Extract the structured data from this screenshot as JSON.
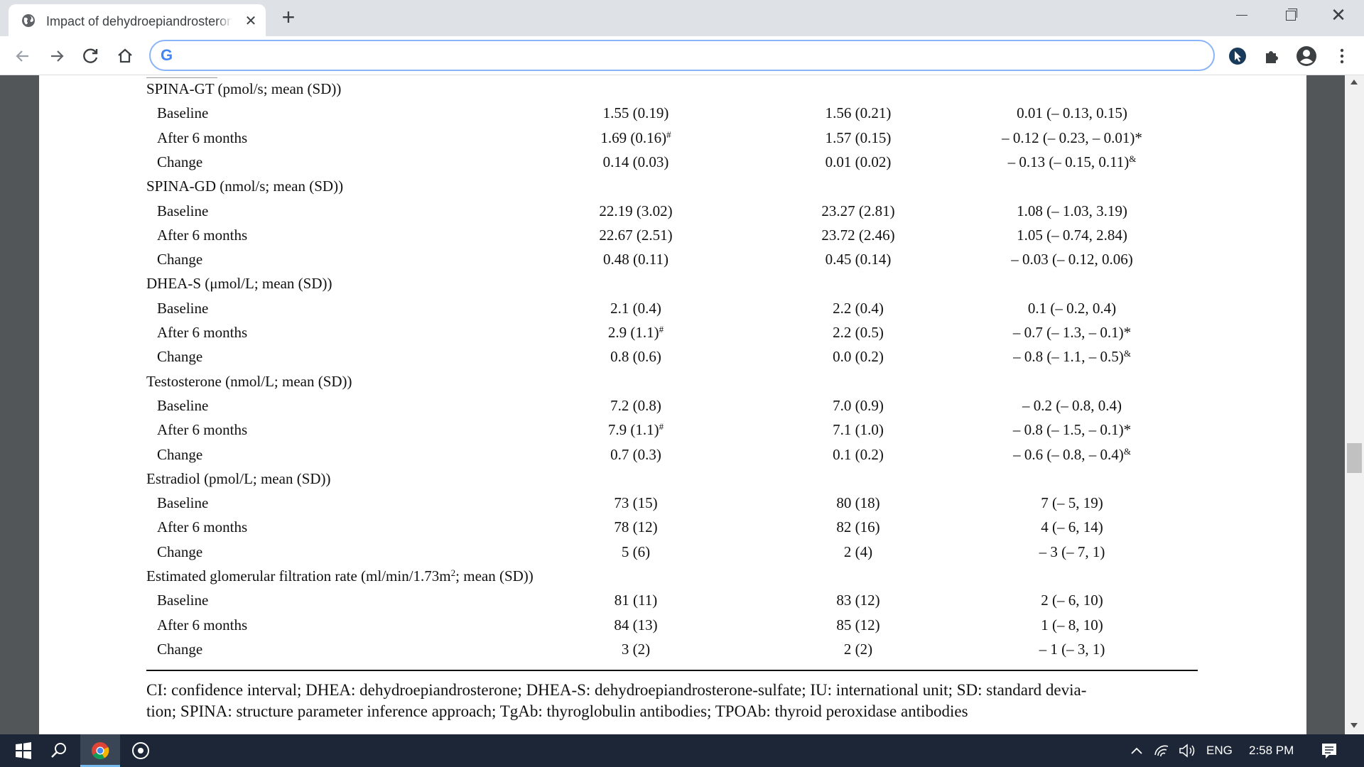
{
  "browser": {
    "tab_title": "Impact of dehydroepiandrosterone",
    "tab_close": "✕",
    "new_tab": "+",
    "window_close": "✕",
    "omnibox_value": ""
  },
  "table": {
    "groups": [
      {
        "label": "SPINA-GT (pmol/s; mean (SD))",
        "rows": [
          {
            "name": "Baseline",
            "c1": "1.55 (0.19)",
            "c1_sup": "",
            "c2": "1.56 (0.21)",
            "c3": "0.01 (– 0.13, 0.15)",
            "c3_sup": ""
          },
          {
            "name": "After 6 months",
            "c1": "1.69 (0.16)",
            "c1_sup": "#",
            "c2": "1.57 (0.15)",
            "c3": "– 0.12 (– 0.23, – 0.01)*",
            "c3_sup": ""
          },
          {
            "name": "Change",
            "c1": "0.14 (0.03)",
            "c1_sup": "",
            "c2": "0.01 (0.02)",
            "c3": "– 0.13 (– 0.15, 0.11)",
            "c3_sup": "&"
          }
        ]
      },
      {
        "label": "SPINA-GD (nmol/s; mean (SD))",
        "rows": [
          {
            "name": "Baseline",
            "c1": "22.19 (3.02)",
            "c1_sup": "",
            "c2": "23.27 (2.81)",
            "c3": "1.08 (– 1.03, 3.19)",
            "c3_sup": ""
          },
          {
            "name": "After 6 months",
            "c1": "22.67 (2.51)",
            "c1_sup": "",
            "c2": "23.72 (2.46)",
            "c3": "1.05 (– 0.74, 2.84)",
            "c3_sup": ""
          },
          {
            "name": "Change",
            "c1": "0.48 (0.11)",
            "c1_sup": "",
            "c2": "0.45 (0.14)",
            "c3": "– 0.03 (– 0.12, 0.06)",
            "c3_sup": ""
          }
        ]
      },
      {
        "label": "DHEA-S (μmol/L; mean (SD))",
        "rows": [
          {
            "name": "Baseline",
            "c1": "2.1 (0.4)",
            "c1_sup": "",
            "c2": "2.2 (0.4)",
            "c3": "0.1 (– 0.2, 0.4)",
            "c3_sup": ""
          },
          {
            "name": "After 6 months",
            "c1": "2.9 (1.1)",
            "c1_sup": "#",
            "c2": "2.2 (0.5)",
            "c3": "– 0.7 (– 1.3, – 0.1)*",
            "c3_sup": ""
          },
          {
            "name": "Change",
            "c1": "0.8 (0.6)",
            "c1_sup": "",
            "c2": "0.0 (0.2)",
            "c3": "– 0.8 (– 1.1, – 0.5)",
            "c3_sup": "&"
          }
        ]
      },
      {
        "label": "Testosterone (nmol/L; mean (SD))",
        "rows": [
          {
            "name": "Baseline",
            "c1": "7.2 (0.8)",
            "c1_sup": "",
            "c2": "7.0 (0.9)",
            "c3": "– 0.2 (– 0.8, 0.4)",
            "c3_sup": ""
          },
          {
            "name": "After 6 months",
            "c1": "7.9 (1.1)",
            "c1_sup": "#",
            "c2": "7.1 (1.0)",
            "c3": "– 0.8 (– 1.5, – 0.1)*",
            "c3_sup": ""
          },
          {
            "name": "Change",
            "c1": "0.7 (0.3)",
            "c1_sup": "",
            "c2": "0.1 (0.2)",
            "c3": "– 0.6 (– 0.8, – 0.4)",
            "c3_sup": "&"
          }
        ]
      },
      {
        "label": "Estradiol (pmol/L; mean (SD))",
        "rows": [
          {
            "name": "Baseline",
            "c1": "73 (15)",
            "c1_sup": "",
            "c2": "80 (18)",
            "c3": "7 (– 5, 19)",
            "c3_sup": ""
          },
          {
            "name": "After 6 months",
            "c1": "78 (12)",
            "c1_sup": "",
            "c2": "82 (16)",
            "c3": "4 (– 6, 14)",
            "c3_sup": ""
          },
          {
            "name": "Change",
            "c1": "5 (6)",
            "c1_sup": "",
            "c2": "2 (4)",
            "c3": "– 3 (– 7, 1)",
            "c3_sup": ""
          }
        ]
      },
      {
        "label_before": "Estimated glomerular filtration rate (ml/min/1.73m",
        "label_sup": "2",
        "label_after": "; mean (SD))",
        "rows": [
          {
            "name": "Baseline",
            "c1": "81 (11)",
            "c1_sup": "",
            "c2": "83 (12)",
            "c3": "2 (– 6, 10)",
            "c3_sup": ""
          },
          {
            "name": "After 6 months",
            "c1": "84 (13)",
            "c1_sup": "",
            "c2": "85 (12)",
            "c3": "1 (– 8, 10)",
            "c3_sup": ""
          },
          {
            "name": "Change",
            "c1": "3 (2)",
            "c1_sup": "",
            "c2": "2 (2)",
            "c3": "– 1 (– 3, 1)",
            "c3_sup": ""
          }
        ]
      }
    ],
    "footnote_line1": "CI: confidence interval; DHEA: dehydroepiandrosterone; DHEA-S: dehydroepiandrosterone-sulfate; IU: international unit; SD: standard devia-",
    "footnote_line2": "tion; SPINA: structure parameter inference approach; TgAb: thyroglobulin antibodies; TPOAb: thyroid peroxidase antibodies"
  },
  "taskbar": {
    "language": "ENG",
    "time": "2:58 PM"
  },
  "colors": {
    "accent": "#8ab4f8",
    "taskbar": "#1c2636",
    "viewer_bg": "#525659"
  }
}
